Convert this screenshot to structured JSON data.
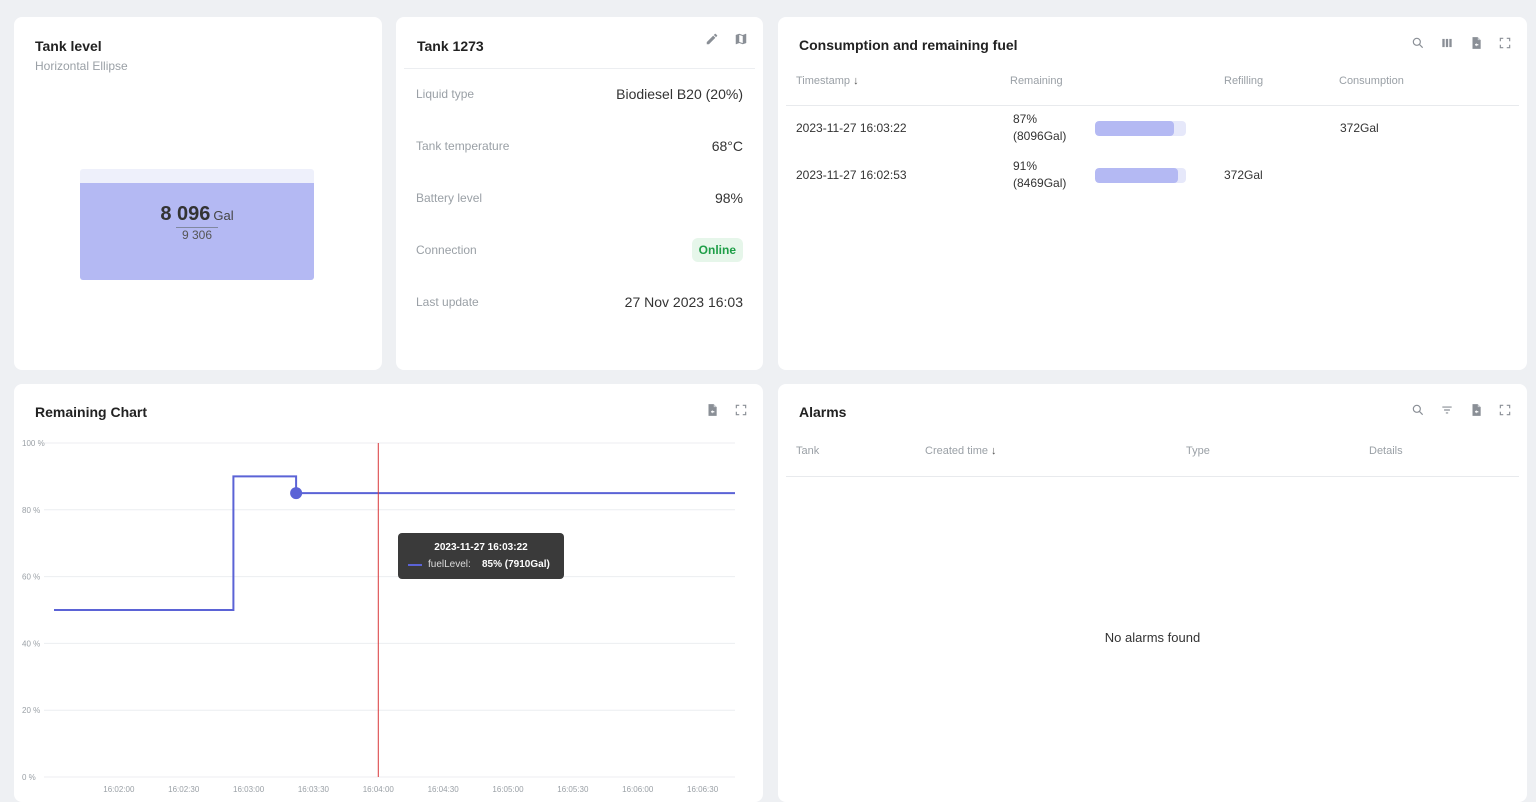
{
  "tank_level": {
    "title": "Tank level",
    "subtitle": "Horizontal Ellipse",
    "value": "8 096",
    "unit": "Gal",
    "capacity": "9 306",
    "fill_fraction": 0.87
  },
  "tank_info": {
    "title": "Tank 1273",
    "rows": [
      {
        "label": "Liquid type",
        "value": "Biodiesel B20 (20%)"
      },
      {
        "label": "Tank temperature",
        "value": "68°C"
      },
      {
        "label": "Battery level",
        "value": "98%"
      },
      {
        "label": "Connection",
        "value": "Online"
      },
      {
        "label": "Last update",
        "value": "27 Nov 2023 16:03"
      }
    ],
    "icons": [
      "pencil-icon",
      "map-icon"
    ]
  },
  "consumption": {
    "title": "Consumption and remaining fuel",
    "columns": [
      "Timestamp",
      "Remaining",
      "Refilling",
      "Consumption"
    ],
    "rows": [
      {
        "timestamp": "2023-11-27 16:03:22",
        "remaining_pct": "87%",
        "remaining_gal": "(8096Gal)",
        "fill": 0.87,
        "refilling": "",
        "consumption": "372Gal"
      },
      {
        "timestamp": "2023-11-27 16:02:53",
        "remaining_pct": "91%",
        "remaining_gal": "(8469Gal)",
        "fill": 0.91,
        "refilling": "372Gal",
        "consumption": ""
      }
    ],
    "icons": [
      "search-icon",
      "columns-icon",
      "export-icon",
      "fullscreen-icon"
    ]
  },
  "remaining_chart": {
    "title": "Remaining Chart",
    "icons": [
      "export-icon",
      "fullscreen-icon"
    ],
    "tooltip": {
      "title": "2023-11-27 16:03:22",
      "series": "fuelLevel:",
      "value": "85% (7910Gal)"
    }
  },
  "chart_data": {
    "type": "line",
    "title": "Remaining Chart",
    "xlabel": "",
    "ylabel": "",
    "ylim": [
      0,
      100
    ],
    "xlim": [
      "16:01:30",
      "16:06:45"
    ],
    "yticks": [
      "0 %",
      "20 %",
      "40 %",
      "60 %",
      "80 %",
      "100 %"
    ],
    "xticks": [
      "16:02:00",
      "16:02:30",
      "16:03:00",
      "16:03:30",
      "16:04:00",
      "16:04:30",
      "16:05:00",
      "16:05:30",
      "16:06:00",
      "16:06:30"
    ],
    "series": [
      {
        "name": "fuelLevel",
        "step": true,
        "points": [
          [
            "16:01:30",
            50
          ],
          [
            "16:02:53",
            50
          ],
          [
            "16:02:53",
            90
          ],
          [
            "16:03:22",
            90
          ],
          [
            "16:03:22",
            85
          ],
          [
            "16:06:45",
            85
          ]
        ]
      }
    ],
    "highlight_point": [
      "16:03:22",
      85
    ],
    "cursor_x": "16:04:00",
    "grid": true,
    "colors": {
      "series": "#5b63d6",
      "cursor": "#d9383a"
    }
  },
  "alarms": {
    "title": "Alarms",
    "columns": [
      "Tank",
      "Created time",
      "Type",
      "Details"
    ],
    "empty_message": "No alarms found",
    "icons": [
      "search-icon",
      "filter-icon",
      "export-icon",
      "fullscreen-icon"
    ]
  }
}
